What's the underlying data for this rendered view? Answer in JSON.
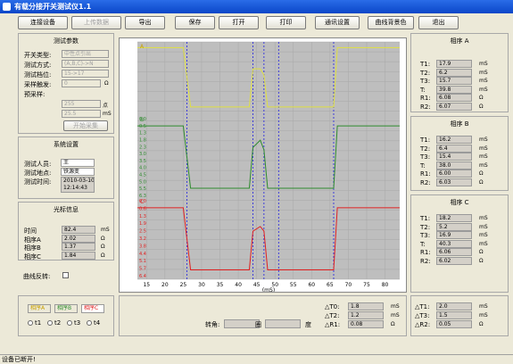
{
  "window": {
    "title": "有载分接开关测试仪1.1"
  },
  "toolbar": {
    "buttons": [
      "连接设备",
      "上传数据",
      "导出",
      "保存",
      "打开",
      "打印",
      "通讯设置",
      "曲线背景色",
      "退出"
    ]
  },
  "params": {
    "title": "测试参数",
    "switch_type": {
      "label": "开关类型:",
      "value": "中性点引出"
    },
    "test_mode": {
      "label": "测试方式:",
      "value": "(A,B,C)->N"
    },
    "test_position": {
      "label": "测试档位:",
      "value": "15->17"
    },
    "trigger": {
      "label": "采样触发:",
      "value": "0",
      "unit": "Ω"
    },
    "presample": {
      "label": "预采样:",
      "points": "255",
      "points_unit": "点",
      "ms": "25.5",
      "ms_unit": "mS"
    },
    "start_button": "开始采集"
  },
  "settings": {
    "title": "系统设置",
    "tester": {
      "label": "测试人员:",
      "value": "王"
    },
    "location": {
      "label": "测试地点:",
      "value": "铁源变"
    },
    "time": {
      "label": "测试时间:",
      "date": "2010-03-10",
      "clock": "12:14:43"
    }
  },
  "cursor": {
    "title": "光标信息",
    "rows": [
      {
        "label": "时间",
        "value": "82.4",
        "unit": "mS"
      },
      {
        "label": "相序A",
        "value": "2.02",
        "unit": "Ω"
      },
      {
        "label": "相序B",
        "value": "1.37",
        "unit": "Ω"
      },
      {
        "label": "相序C",
        "value": "1.84",
        "unit": "Ω"
      }
    ]
  },
  "reverse": {
    "label": "曲线反转:"
  },
  "legend": {
    "a": "相序A",
    "b": "相序B",
    "c": "相序C",
    "colors": {
      "a": "#E0E040",
      "b": "#2E8B2E",
      "c": "#E02020"
    }
  },
  "radios": [
    "t1",
    "t2",
    "t3",
    "t4"
  ],
  "chart_data": {
    "type": "line",
    "xlabel": "(mS)",
    "xlim": [
      12.5,
      84
    ],
    "xticks": [
      15,
      20,
      25,
      30,
      35,
      40,
      45,
      50,
      55,
      60,
      65,
      70,
      75,
      80
    ],
    "panel_labels": [
      "A",
      "B",
      "C"
    ],
    "yticks_b": [
      "0.0",
      "0.5",
      "1.3",
      "1.8",
      "2.3",
      "3.0",
      "3.5",
      "4.0",
      "4.5",
      "5.0",
      "5.5",
      "6.3"
    ],
    "yticks_c": [
      "0.0",
      "0.6",
      "1.3",
      "1.9",
      "2.5",
      "3.2",
      "3.8",
      "4.4",
      "5.1",
      "5.7",
      "6.4"
    ],
    "cursor_lines_ms": [
      26,
      44,
      47,
      51,
      66
    ],
    "series": [
      {
        "color": "#E0E040",
        "x": [
          12.5,
          25,
          27,
          43,
          44,
          46,
          47,
          48,
          66,
          67,
          84
        ],
        "y": [
          0.2,
          0.2,
          5.8,
          5.8,
          2.2,
          2.2,
          2.8,
          5.8,
          5.8,
          0.2,
          0.2
        ]
      },
      {
        "color": "#2E8B2E",
        "x": [
          12.5,
          25,
          27,
          43,
          44,
          46,
          47,
          48,
          66,
          67,
          84
        ],
        "y": [
          0.6,
          0.6,
          5.8,
          5.8,
          2.4,
          1.8,
          2.6,
          5.8,
          5.8,
          0.6,
          0.6
        ]
      },
      {
        "color": "#E02020",
        "x": [
          12.5,
          25,
          27,
          43,
          44,
          46,
          47,
          48,
          66,
          67,
          84
        ],
        "y": [
          0.6,
          0.6,
          5.9,
          5.9,
          2.6,
          2.2,
          2.6,
          5.9,
          5.9,
          0.6,
          0.6
        ]
      }
    ]
  },
  "bottom": {
    "angle_label": "转角:",
    "angle_unit1": "圈",
    "angle_unit2": "度"
  },
  "delta_mid": [
    {
      "label": "△T0:",
      "value": "1.8",
      "unit": "mS"
    },
    {
      "label": "△T2:",
      "value": "1.2",
      "unit": "mS"
    },
    {
      "label": "△R1:",
      "value": "0.08",
      "unit": "Ω"
    }
  ],
  "delta_right": [
    {
      "label": "△T1:",
      "value": "2.0",
      "unit": "mS"
    },
    {
      "label": "△T3:",
      "value": "1.5",
      "unit": "mS"
    },
    {
      "label": "△R2:",
      "value": "0.05",
      "unit": "Ω"
    }
  ],
  "phaseA": {
    "title": "相序 A",
    "rows": [
      {
        "label": "T1:",
        "value": "17.9",
        "unit": "mS"
      },
      {
        "label": "T2:",
        "value": "6.2",
        "unit": "mS"
      },
      {
        "label": "T3:",
        "value": "15.7",
        "unit": "mS"
      },
      {
        "label": "T:",
        "value": "39.8",
        "unit": "mS"
      },
      {
        "label": "R1:",
        "value": "6.08",
        "unit": "Ω"
      },
      {
        "label": "R2:",
        "value": "6.07",
        "unit": "Ω"
      }
    ]
  },
  "phaseB": {
    "title": "相序 B",
    "rows": [
      {
        "label": "T1:",
        "value": "16.2",
        "unit": "mS"
      },
      {
        "label": "T2:",
        "value": "6.4",
        "unit": "mS"
      },
      {
        "label": "T3:",
        "value": "15.4",
        "unit": "mS"
      },
      {
        "label": "T:",
        "value": "38.0",
        "unit": "mS"
      },
      {
        "label": "R1:",
        "value": "6.00",
        "unit": "Ω"
      },
      {
        "label": "R2:",
        "value": "6.03",
        "unit": "Ω"
      }
    ]
  },
  "phaseC": {
    "title": "相序 C",
    "rows": [
      {
        "label": "T1:",
        "value": "18.2",
        "unit": "mS"
      },
      {
        "label": "T2:",
        "value": "5.2",
        "unit": "mS"
      },
      {
        "label": "T3:",
        "value": "16.9",
        "unit": "mS"
      },
      {
        "label": "T:",
        "value": "40.3",
        "unit": "mS"
      },
      {
        "label": "R1:",
        "value": "6.06",
        "unit": "Ω"
      },
      {
        "label": "R2:",
        "value": "6.02",
        "unit": "Ω"
      }
    ]
  },
  "status": {
    "text": "设备已断开!"
  }
}
